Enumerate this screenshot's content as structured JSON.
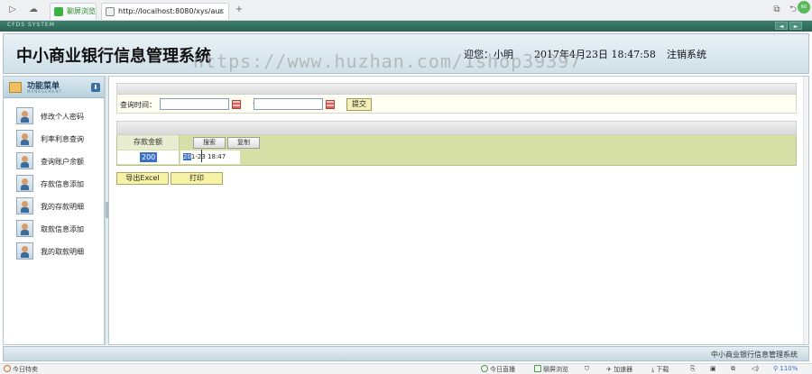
{
  "browser": {
    "tabs": [
      {
        "label": "聊屏浏览"
      },
      {
        "label": "http://localhost:8080/xys/aus",
        "close": "×"
      }
    ],
    "new_tab": "+",
    "ext_badge": "60"
  },
  "window": {
    "system_label": "CFDS SYSTEM",
    "prev": "◄",
    "next": "►"
  },
  "header": {
    "title": "中小商业银行信息管理系统",
    "welcome": "迎您：小明",
    "datetime": "2017年4月23日  18:47:58",
    "logout": "注销系统"
  },
  "watermark": "https://www.huzhan.com/1shop39397",
  "sidebar": {
    "title": "功能菜单",
    "subtitle": "MANAGEMENT",
    "toggle": "⬇",
    "items": [
      {
        "label": "修改个人密码"
      },
      {
        "label": "利率利息查询"
      },
      {
        "label": "查询账户余额"
      },
      {
        "label": "存款信息添加"
      },
      {
        "label": "我的存款明细"
      },
      {
        "label": "取款信息添加"
      },
      {
        "label": "我的取款明细"
      }
    ]
  },
  "query": {
    "label": "查询时间：",
    "start_value": "",
    "separator": "—",
    "end_value": "",
    "submit": "提交"
  },
  "results": {
    "header_amount": "存款金额",
    "search_btn": "搜索",
    "copy_btn": "复制",
    "amount": "200",
    "time_selected": "20",
    "time_rest": "1-23 18:47"
  },
  "actions": {
    "export": "导出Excel",
    "print": "打印"
  },
  "footer": {
    "text": "中小商业银行信息管理系统"
  },
  "statusbar": {
    "left": "今日特卖",
    "live": "今日直播",
    "screen": "聊屏浏览",
    "accel": "加速器",
    "download": "下载",
    "zoom": "110%"
  }
}
